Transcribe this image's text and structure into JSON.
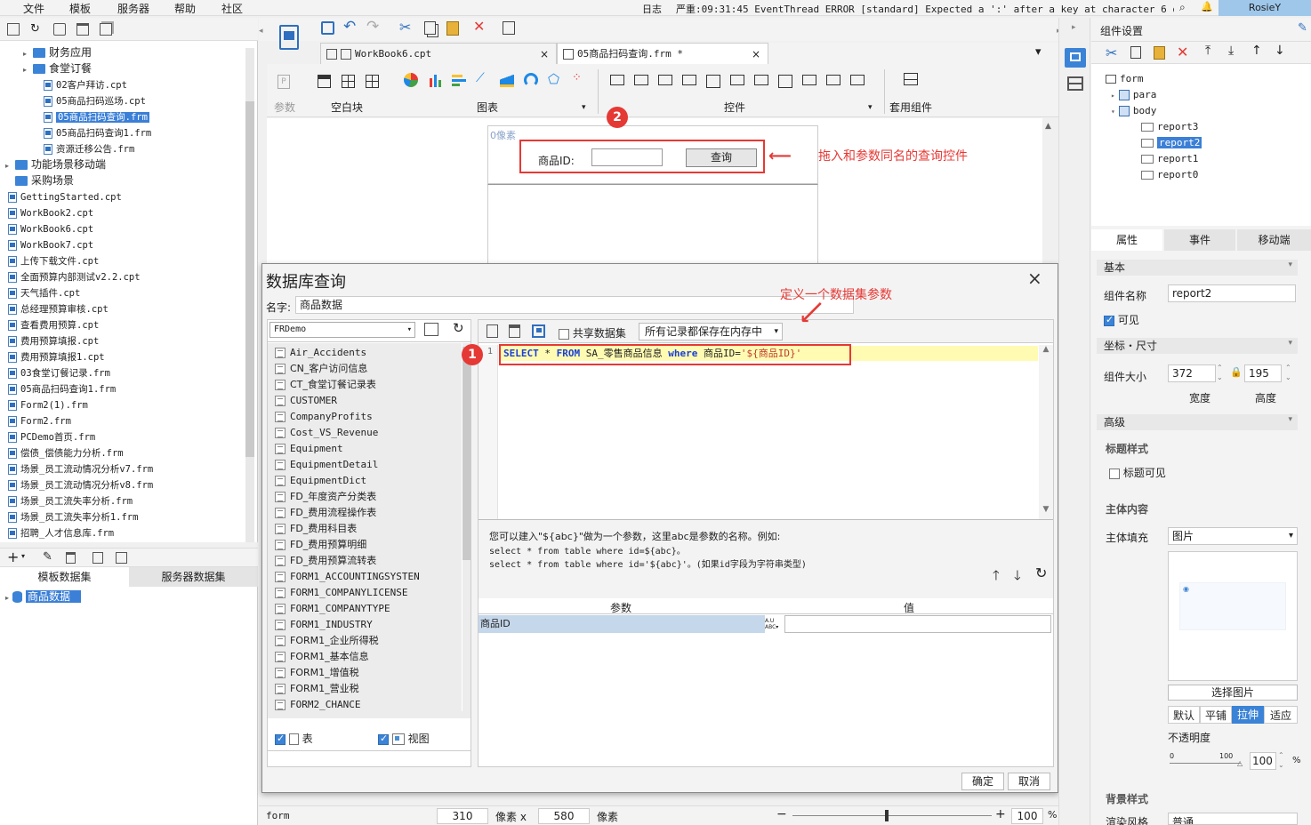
{
  "menu": {
    "items": [
      "文件",
      "模板",
      "服务器",
      "帮助",
      "社区"
    ]
  },
  "log": {
    "label": "日志",
    "text": "严重:09:31:45 EventThread ERROR [standard] Expected a ':' after a key at character 6 of {n...",
    "user": "RosieY"
  },
  "left_tree": [
    {
      "label": "财务应用",
      "type": "folder",
      "indent": 2,
      "arrow": "▸"
    },
    {
      "label": "食堂订餐",
      "type": "folder",
      "indent": 2,
      "arrow": "▸"
    },
    {
      "label": "02客户拜访.cpt",
      "type": "file",
      "indent": 3
    },
    {
      "label": "05商品扫码巡场.cpt",
      "type": "file",
      "indent": 3
    },
    {
      "label": "05商品扫码查询.frm",
      "type": "file",
      "indent": 3,
      "selected": true
    },
    {
      "label": "05商品扫码查询1.frm",
      "type": "file",
      "indent": 3
    },
    {
      "label": "资源迁移公告.frm",
      "type": "file",
      "indent": 3
    },
    {
      "label": "功能场景移动端",
      "type": "folder",
      "indent": 1,
      "arrow": "▸"
    },
    {
      "label": "采购场景",
      "type": "folder",
      "indent": 1
    },
    {
      "label": "GettingStarted.cpt",
      "type": "file",
      "indent": 1
    },
    {
      "label": "WorkBook2.cpt",
      "type": "file",
      "indent": 1
    },
    {
      "label": "WorkBook6.cpt",
      "type": "file",
      "indent": 1
    },
    {
      "label": "WorkBook7.cpt",
      "type": "file",
      "indent": 1
    },
    {
      "label": "上传下载文件.cpt",
      "type": "file",
      "indent": 1
    },
    {
      "label": "全面预算内部测试v2.2.cpt",
      "type": "file",
      "indent": 1
    },
    {
      "label": "天气插件.cpt",
      "type": "file",
      "indent": 1
    },
    {
      "label": "总经理预算审核.cpt",
      "type": "file",
      "indent": 1
    },
    {
      "label": "查看费用预算.cpt",
      "type": "file",
      "indent": 1
    },
    {
      "label": "费用预算填报.cpt",
      "type": "file",
      "indent": 1
    },
    {
      "label": "费用预算填报1.cpt",
      "type": "file",
      "indent": 1
    },
    {
      "label": "03食堂订餐记录.frm",
      "type": "file",
      "indent": 1
    },
    {
      "label": "05商品扫码查询1.frm",
      "type": "file",
      "indent": 1
    },
    {
      "label": "Form2(1).frm",
      "type": "file",
      "indent": 1
    },
    {
      "label": "Form2.frm",
      "type": "file",
      "indent": 1
    },
    {
      "label": "PCDemo首页.frm",
      "type": "file",
      "indent": 1
    },
    {
      "label": "偿债_偿债能力分析.frm",
      "type": "file",
      "indent": 1
    },
    {
      "label": "场景_员工流动情况分析v7.frm",
      "type": "file",
      "indent": 1
    },
    {
      "label": "场景_员工流动情况分析v8.frm",
      "type": "file",
      "indent": 1
    },
    {
      "label": "场景_员工流失率分析.frm",
      "type": "file",
      "indent": 1
    },
    {
      "label": "场景_员工流失率分析1.frm",
      "type": "file",
      "indent": 1
    },
    {
      "label": "招聘_人才信息库.frm",
      "type": "file",
      "indent": 1
    }
  ],
  "dataset_tabs": {
    "template": "模板数据集",
    "server": "服务器数据集",
    "item": "商品数据"
  },
  "tabs": [
    {
      "label": "WorkBook6.cpt"
    },
    {
      "label": "05商品扫码查询.frm *"
    }
  ],
  "ribbon": {
    "param": "参数",
    "blank": "空白块",
    "chart": "图表",
    "control": "控件",
    "apply": "套用组件"
  },
  "canvas": {
    "pixel_label": "0像素",
    "query_label": "商品ID:",
    "query_button": "查询"
  },
  "annotations": {
    "drag": "拖入和参数同名的查询控件",
    "define": "定义一个数据集参数",
    "badge1": "1",
    "badge2": "2"
  },
  "dialog": {
    "title": "数据库查询",
    "name_label": "名字:",
    "name_value": "商品数据",
    "connection": "FRDemo",
    "shared": "共享数据集",
    "memory": "所有记录都保存在内存中",
    "tables": [
      "Air_Accidents",
      "CN_客户访问信息",
      "CT_食堂订餐记录表",
      "CUSTOMER",
      "CompanyProfits",
      "Cost_VS_Revenue",
      "Equipment",
      "EquipmentDetail",
      "EquipmentDict",
      "FD_年度资产分类表",
      "FD_费用流程操作表",
      "FD_费用科目表",
      "FD_费用预算明细",
      "FD_费用预算流转表",
      "FORM1_ACCOUNTINGSYSTEN",
      "FORM1_COMPANYLICENSE",
      "FORM1_COMPANYTYPE",
      "FORM1_INDUSTRY",
      "FORM1_企业所得税",
      "FORM1_基本信息",
      "FORM1_增值税",
      "FORM1_营业税",
      "FORM2_CHANCE"
    ],
    "tbl_check": "表",
    "view_check": "视图",
    "line_no": "1",
    "sql": {
      "kw1": "SELECT",
      "star": " * ",
      "kw2": "FROM",
      "table": " SA_零售商品信息 ",
      "kw3": "where",
      "field": " 商品ID=",
      "param": "'${商品ID}'"
    },
    "hint1": "您可以建入\"${abc}\"做为一个参数，这里abc是参数的名称。例如:",
    "hint2": "select * from table where id=${abc}。",
    "hint3": "select * from table where id='${abc}'。(如果id字段为字符串类型)",
    "param_col": "参数",
    "value_col": "值",
    "param_name": "商品ID",
    "ok": "确定",
    "cancel": "取消"
  },
  "status": {
    "form": "form",
    "w": "310",
    "px1": "像素 x",
    "h": "580",
    "px2": "像素",
    "zoom": "100",
    "pct": "%"
  },
  "right_panel": {
    "title": "组件设置",
    "tree": [
      "form",
      "para",
      "body",
      "report3",
      "report2",
      "report1",
      "report0"
    ],
    "tabs": [
      "属性",
      "事件",
      "移动端"
    ],
    "basic": "基本",
    "comp_name_label": "组件名称",
    "comp_name": "report2",
    "visible": "可见",
    "coord": "坐标・尺寸",
    "size_label": "组件大小",
    "width": "372",
    "height": "195",
    "width_label": "宽度",
    "height_label": "高度",
    "advanced": "高级",
    "title_style": "标题样式",
    "title_visible": "标题可见",
    "body_content": "主体内容",
    "body_fill": "主体填充",
    "fill_value": "图片",
    "choose_image": "选择图片",
    "fit_modes": [
      "默认",
      "平铺",
      "拉伸",
      "适应"
    ],
    "opacity": "不透明度",
    "slider_min": "0",
    "slider_max": "100",
    "opacity_value": "100",
    "pct": "%",
    "bg_style": "背景样式",
    "render_style": "渲染风格",
    "render_value": "普通"
  }
}
